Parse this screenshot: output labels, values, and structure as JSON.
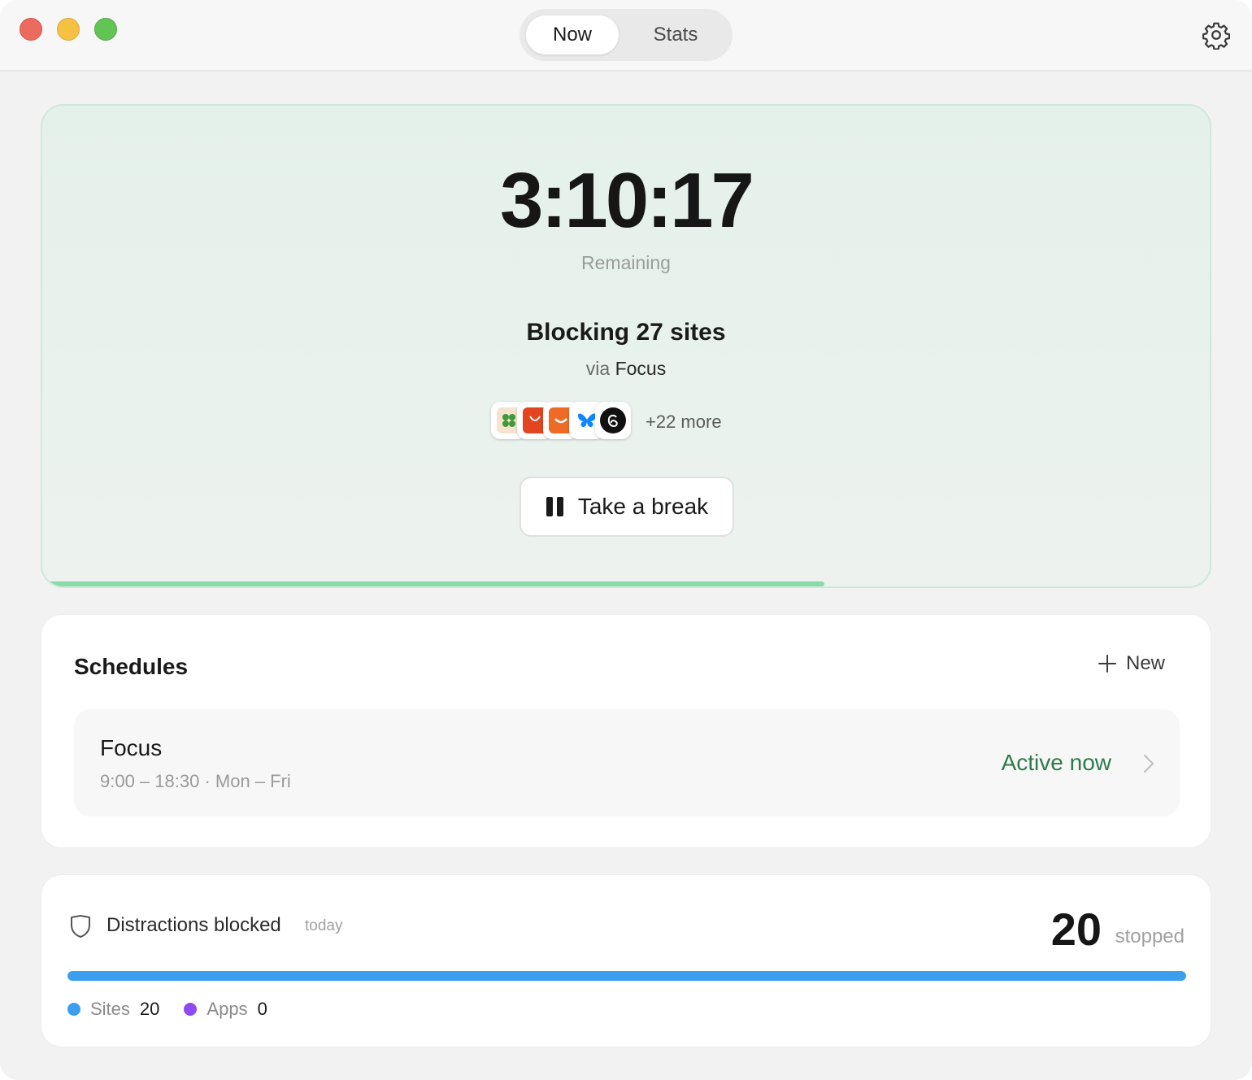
{
  "tabs": [
    {
      "label": "Now",
      "selected": true
    },
    {
      "label": "Stats",
      "selected": false
    }
  ],
  "hero": {
    "timer": "3:10:17",
    "timer_caption": "Remaining",
    "blocking_text": "Blocking 27 sites",
    "via_prefix": "via",
    "via_name": "Focus",
    "blocked_icons": [
      "clover-icon",
      "aliexpress-icon",
      "shopping-bag-icon",
      "butterfly-icon",
      "threads-icon"
    ],
    "more_text": "+22 more",
    "break_label": "Take a break",
    "progress_fraction": 0.67,
    "accent_color": "#86dba8"
  },
  "schedules": {
    "title": "Schedules",
    "new_label": "New",
    "items": [
      {
        "name": "Focus",
        "time": "9:00 – 18:30 · Mon – Fri",
        "status": "Active now",
        "status_color": "#2f7a4c"
      }
    ]
  },
  "distractions": {
    "title": "Distractions blocked",
    "period": "today",
    "count": "20",
    "count_label": "stopped",
    "sites_fraction": 1.0,
    "legend": [
      {
        "label": "Sites",
        "value": "20",
        "color": "#3c9eee"
      },
      {
        "label": "Apps",
        "value": "0",
        "color": "#8e4cf0"
      }
    ]
  }
}
